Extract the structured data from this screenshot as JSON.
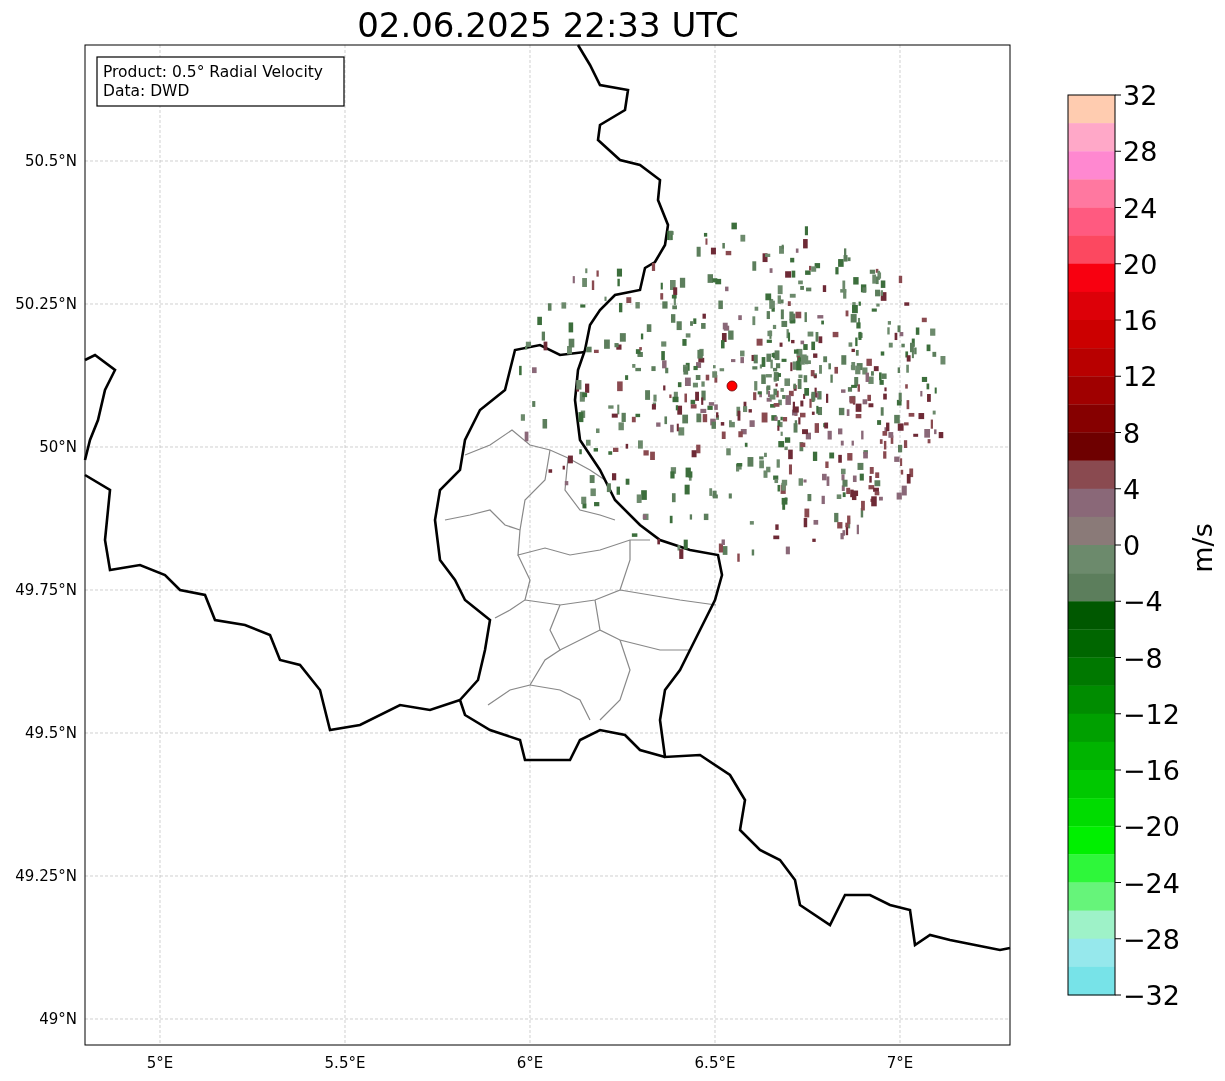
{
  "title": "02.06.2025 22:33 UTC",
  "info_box": {
    "lines": [
      "Product: 0.5° Radial Velocity",
      "Data: DWD"
    ]
  },
  "map": {
    "lat_ticks": [
      "50.5°N",
      "50.25°N",
      "50°N",
      "49.75°N",
      "49.5°N",
      "49.25°N",
      "49°N"
    ],
    "lon_ticks": [
      "5°E",
      "5.5°E",
      "6°E",
      "6.5°E",
      "7°E"
    ]
  },
  "colorbar": {
    "label": "m/s",
    "ticks": [
      "32",
      "28",
      "24",
      "20",
      "16",
      "12",
      "8",
      "4",
      "0",
      "−4",
      "−8",
      "−12",
      "−16",
      "−20",
      "−24",
      "−28",
      "−32"
    ],
    "bins": [
      {
        "color": "#ffccb0"
      },
      {
        "color": "#ffa8c8"
      },
      {
        "color": "#ff88d0"
      },
      {
        "color": "#ff78a0"
      },
      {
        "color": "#ff5a80"
      },
      {
        "color": "#fc4860"
      },
      {
        "color": "#f80010"
      },
      {
        "color": "#dd0008"
      },
      {
        "color": "#cc0000"
      },
      {
        "color": "#b80000"
      },
      {
        "color": "#a00000"
      },
      {
        "color": "#860000"
      },
      {
        "color": "#6e0000"
      },
      {
        "color": "#8a4a50"
      },
      {
        "color": "#8a6878"
      },
      {
        "color": "#8a7a78"
      },
      {
        "color": "#6c8a6c"
      },
      {
        "color": "#5c7e5c"
      },
      {
        "color": "#005800"
      },
      {
        "color": "#006600"
      },
      {
        "color": "#007800"
      },
      {
        "color": "#008c00"
      },
      {
        "color": "#00a000"
      },
      {
        "color": "#00b400"
      },
      {
        "color": "#00c800"
      },
      {
        "color": "#00dc00"
      },
      {
        "color": "#00f000"
      },
      {
        "color": "#2ef73a"
      },
      {
        "color": "#66f47a"
      },
      {
        "color": "#9ef2c8"
      },
      {
        "color": "#96e8ec"
      },
      {
        "color": "#77e3e8"
      }
    ]
  }
}
